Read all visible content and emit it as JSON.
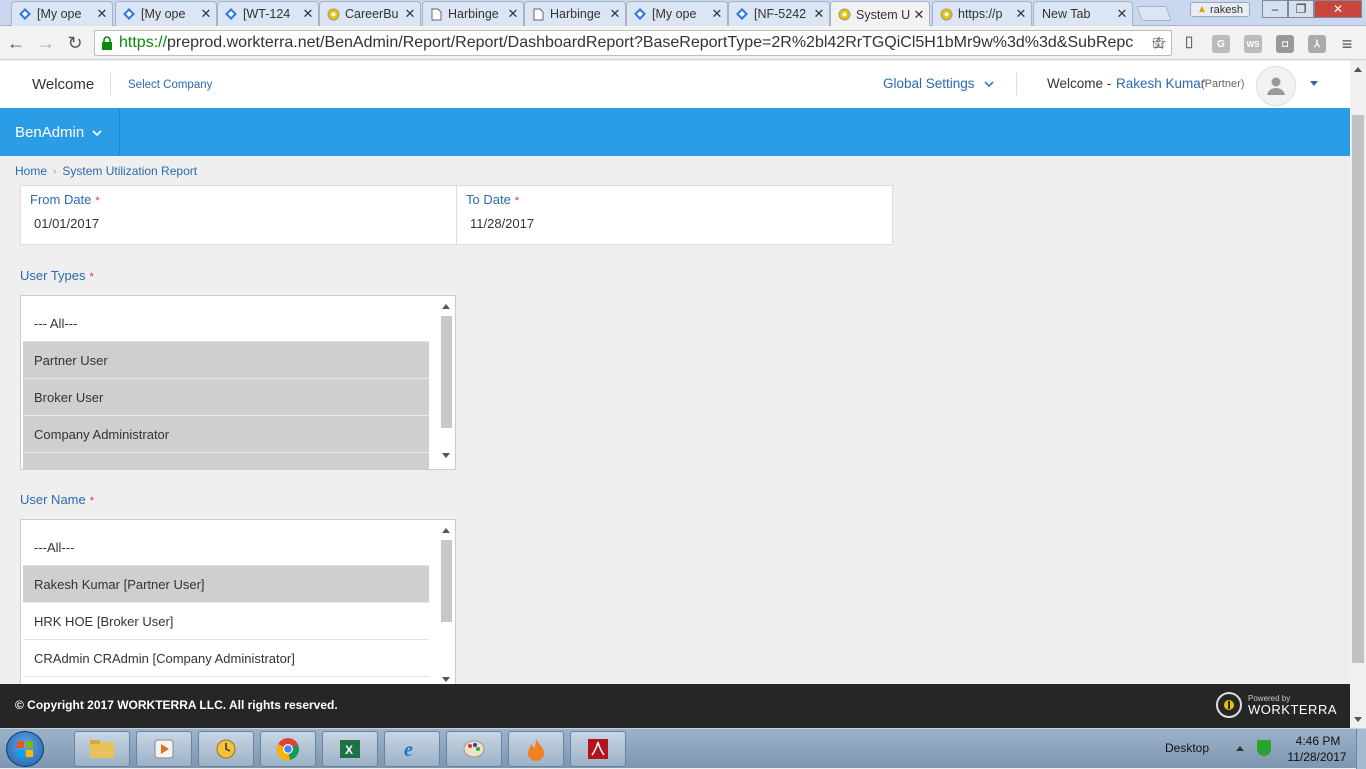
{
  "browser": {
    "tabs": [
      {
        "title": "[My ope",
        "icon": "diamond-icon"
      },
      {
        "title": "[My ope",
        "icon": "diamond-icon"
      },
      {
        "title": "[WT-124",
        "icon": "diamond-icon"
      },
      {
        "title": "CareerBu",
        "icon": "gear-icon"
      },
      {
        "title": "Harbinge",
        "icon": "document-icon"
      },
      {
        "title": "Harbinge",
        "icon": "document-icon"
      },
      {
        "title": "[My ope",
        "icon": "diamond-icon"
      },
      {
        "title": "[NF-5242",
        "icon": "diamond-icon"
      },
      {
        "title": "System U",
        "icon": "gear-icon",
        "active": true
      },
      {
        "title": "https://p",
        "icon": "gear-icon"
      },
      {
        "title": "New Tab",
        "icon": ""
      }
    ],
    "profile_name": "rakesh",
    "url_scheme": "https://",
    "url_rest": "preprod.workterra.net/BenAdmin/Report/Report/DashboardReport?BaseReportType=2R%2bl42RrTGQiCl5H1bMr9w%3d%3d&SubRepc"
  },
  "header": {
    "welcome_title": "Welcome",
    "select_company": "Select Company",
    "global_settings": "Global Settings",
    "welcome_label": "Welcome -",
    "user_name": "Rakesh Kumar",
    "user_role": "(Partner)"
  },
  "nav": {
    "menu_label": "BenAdmin"
  },
  "breadcrumb": {
    "home": "Home",
    "current": "System Utilization Report"
  },
  "form": {
    "from_date_label": "From Date",
    "from_date_value": "01/01/2017",
    "to_date_label": "To Date",
    "to_date_value": "11/28/2017",
    "required_marker": "*",
    "user_types_label": "User Types",
    "user_types": [
      {
        "label": "--- All---",
        "selected": false
      },
      {
        "label": "Partner User",
        "selected": true
      },
      {
        "label": "Broker User",
        "selected": true
      },
      {
        "label": "Company Administrator",
        "selected": true
      }
    ],
    "user_name_label": "User Name",
    "user_names": [
      {
        "label": "---All---",
        "selected": false
      },
      {
        "label": "Rakesh Kumar [Partner User]",
        "selected": true
      },
      {
        "label": "HRK HOE [Broker User]",
        "selected": false
      },
      {
        "label": "CRAdmin CRAdmin [Company Administrator]",
        "selected": false
      }
    ]
  },
  "footer": {
    "copyright": "© Copyright 2017 WORKTERRA LLC. All rights reserved.",
    "powered_by": "Powered by",
    "brand": "WORKTERRA"
  },
  "taskbar": {
    "desktop_label": "Desktop",
    "time": "4:46 PM",
    "date": "11/28/2017"
  },
  "colors": {
    "accent": "#2b9ce6",
    "link": "#2a6ab3",
    "footer_bg": "#262626"
  }
}
